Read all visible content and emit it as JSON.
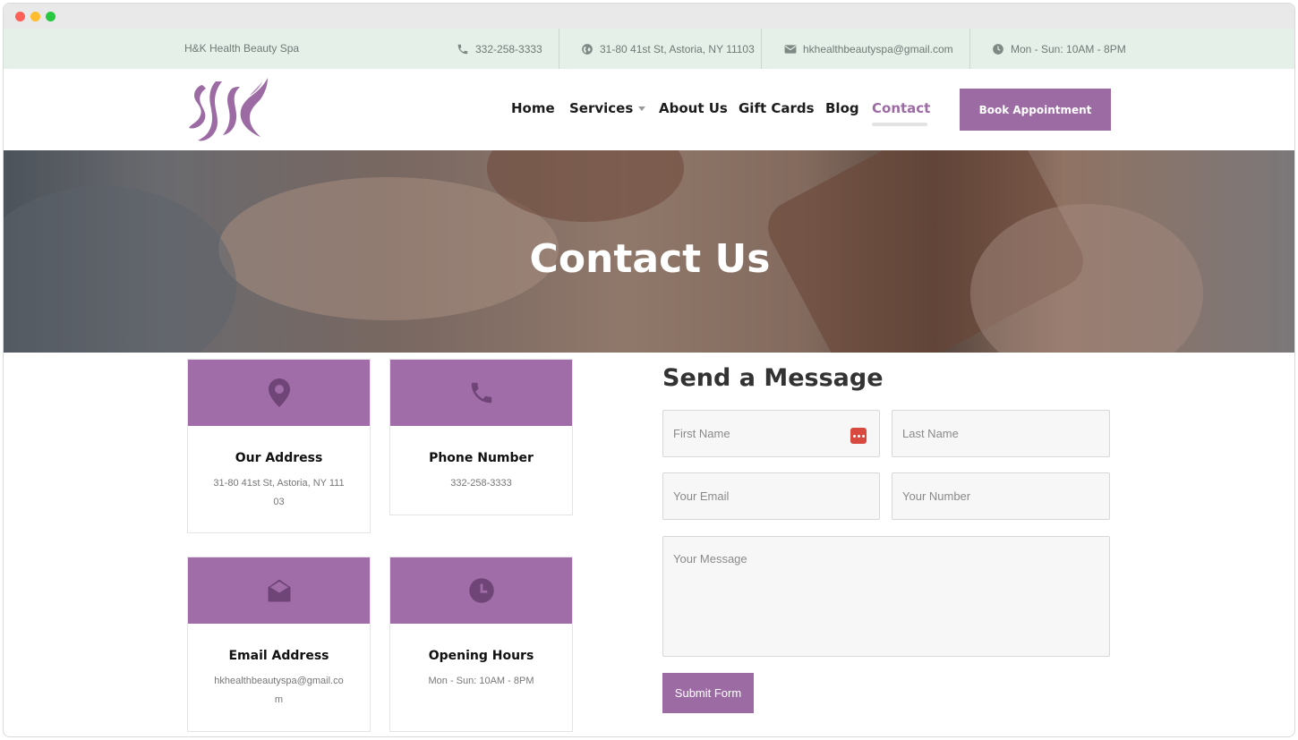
{
  "topbar": {
    "brand": "H&K Health Beauty Spa",
    "phone": "332-258-3333",
    "address": "31-80 41st St, Astoria, NY 11103",
    "email": "hkhealthbeautyspa@gmail.com",
    "hours": "Mon - Sun: 10AM - 8PM"
  },
  "nav": {
    "items": [
      "Home",
      "Services",
      "About Us",
      "Gift Cards",
      "Blog",
      "Contact"
    ],
    "active": "Contact",
    "cta": "Book Appointment"
  },
  "hero": {
    "title": "Contact Us"
  },
  "cards": [
    {
      "title": "Our Address",
      "text": "31-80 41st St, Astoria, NY 11103",
      "icon": "location-pin-icon"
    },
    {
      "title": "Phone Number",
      "text": "332-258-3333",
      "icon": "phone-icon"
    },
    {
      "title": "Email Address",
      "text": "hkhealthbeautyspa@gmail.com",
      "icon": "envelope-open-icon"
    },
    {
      "title": "Opening Hours",
      "text": "Mon - Sun: 10AM - 8PM",
      "icon": "clock-icon"
    }
  ],
  "form": {
    "title": "Send a Message",
    "first_name_placeholder": "First Name",
    "last_name_placeholder": "Last Name",
    "email_placeholder": "Your Email",
    "number_placeholder": "Your Number",
    "message_placeholder": "Your Message",
    "submit_label": "Submit Form"
  },
  "colors": {
    "accent": "#9c6ba4",
    "topbar_bg": "#e5f0e9",
    "card_header": "#a06da8"
  }
}
